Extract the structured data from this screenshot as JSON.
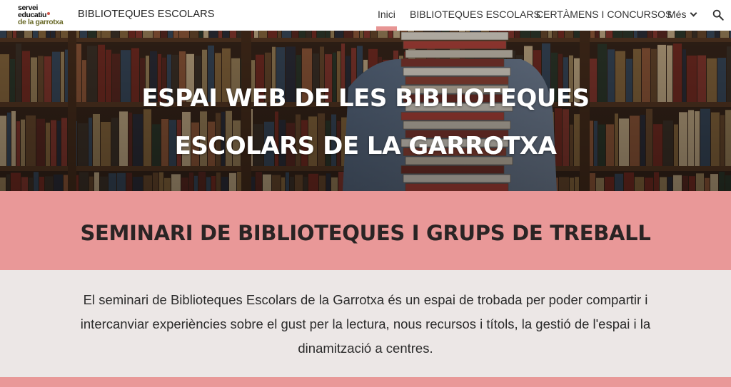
{
  "header": {
    "logo_lines": [
      "servei",
      "educatiu",
      "de la garrotxa"
    ],
    "site_title": "BIBLIOTEQUES ESCOLARS",
    "nav": [
      {
        "label": "Inici",
        "active": true
      },
      {
        "label": "BIBLIOTEQUES ESCOLARS",
        "active": false
      },
      {
        "label": "CERTÀMENS I CONCURSOS",
        "active": false
      },
      {
        "label": "Més",
        "active": false
      }
    ],
    "search_icon": "search-icon",
    "more_icon": "chevron-down-icon"
  },
  "hero": {
    "title_line1": "ESPAI WEB DE LES BIBLIOTEQUES",
    "title_line2": "ESCOLARS DE LA GARROTXA"
  },
  "section": {
    "heading": "SEMINARI DE BIBLIOTEQUES I GRUPS DE TREBALL",
    "body": "El seminari de Biblioteques Escolars de la Garrotxa és un espai de trobada per poder compartir i intercanviar experiències sobre el gust per la lectura, nous recursos i títols, la gestió de l'espai i la dinamització a centres."
  },
  "colors": {
    "accent": "#e99898",
    "section_bg": "#ece7e6"
  }
}
